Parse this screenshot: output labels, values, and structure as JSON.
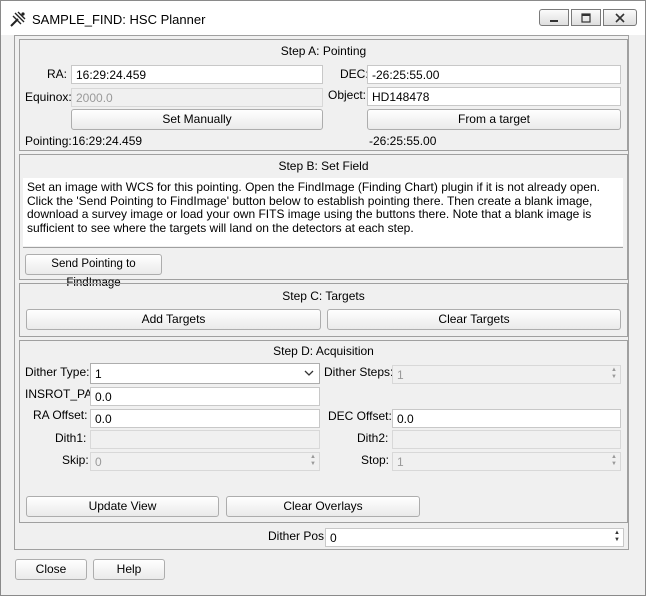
{
  "window": {
    "title": "SAMPLE_FIND: HSC Planner"
  },
  "stepA": {
    "title": "Step A: Pointing",
    "ra_label": "RA:",
    "ra_value": "16:29:24.459",
    "dec_label": "DEC:",
    "dec_value": "-26:25:55.00",
    "equinox_label": "Equinox:",
    "equinox_value": "2000.0",
    "object_label": "Object:",
    "object_value": "HD148478",
    "set_manually_label": "Set Manually",
    "from_target_label": "From a target",
    "pointing_label": "Pointing:",
    "pointing_ra": "16:29:24.459",
    "pointing_dec": "-26:25:55.00"
  },
  "stepB": {
    "title": "Step B: Set Field",
    "instructions": "Set an image with WCS for this pointing. Open the FindImage (Finding Chart) plugin if it is not already open.  Click the 'Send Pointing to FindImage' button below to establish pointing there. Then create a blank image, download a survey image or load your own FITS image using the buttons there. Note that a blank image is sufficient to see where the targets will land on the detectors at each step.",
    "send_pointing_label": "Send Pointing to FindImage"
  },
  "stepC": {
    "title": "Step C: Targets",
    "add_targets_label": "Add Targets",
    "clear_targets_label": "Clear Targets"
  },
  "stepD": {
    "title": "Step D: Acquisition",
    "dither_type_label": "Dither Type:",
    "dither_type_value": "1",
    "dither_steps_label": "Dither Steps:",
    "dither_steps_value": "1",
    "insrot_pa_label": "INSROT_PA:",
    "insrot_pa_value": "0.0",
    "ra_offset_label": "RA Offset:",
    "ra_offset_value": "0.0",
    "dec_offset_label": "DEC Offset:",
    "dec_offset_value": "0.0",
    "dith1_label": "Dith1:",
    "dith1_value": "",
    "dith2_label": "Dith2:",
    "dith2_value": "",
    "skip_label": "Skip:",
    "skip_value": "0",
    "stop_label": "Stop:",
    "stop_value": "1",
    "update_view_label": "Update View",
    "clear_overlays_label": "Clear Overlays"
  },
  "dither_pos": {
    "label": "Dither Pos:",
    "value": "0"
  },
  "footer": {
    "close_label": "Close",
    "help_label": "Help"
  }
}
